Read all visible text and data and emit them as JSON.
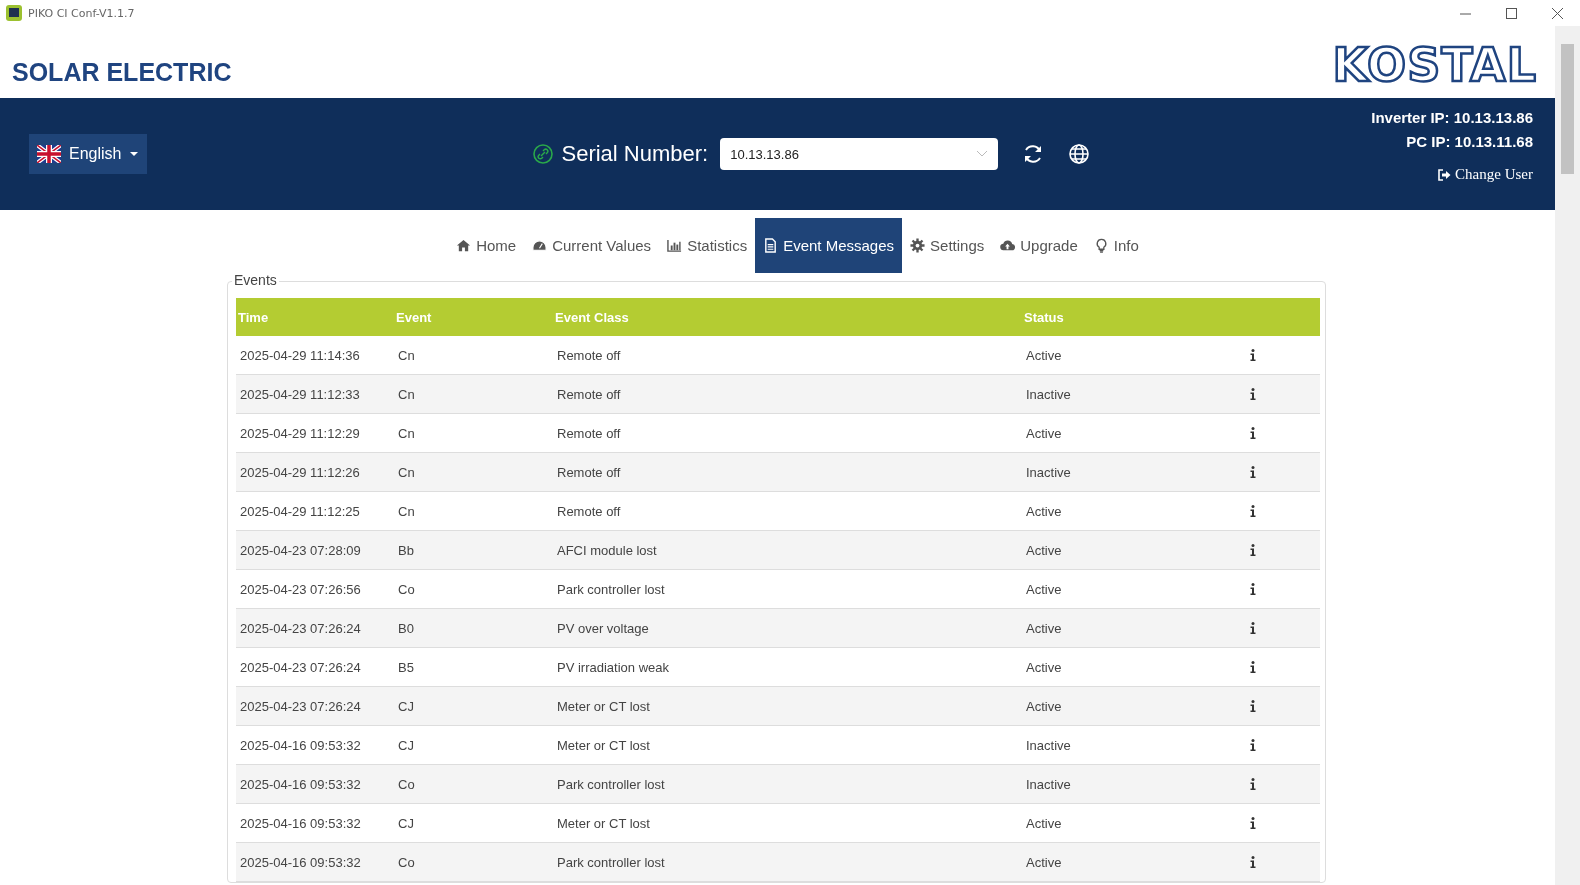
{
  "window": {
    "title": "PIKO CI Conf-V1.1.7"
  },
  "header": {
    "brand": "SOLAR ELECTRIC",
    "logo": "KOSTAL"
  },
  "toolbar": {
    "language": "English",
    "serial_label": "Serial Number:",
    "serial_value": "10.13.13.86",
    "inverter_ip": "Inverter IP: 10.13.13.86",
    "pc_ip": "PC IP: 10.13.11.68",
    "change_user": "Change User"
  },
  "tabs": [
    {
      "label": "Home",
      "selected": false
    },
    {
      "label": "Current Values",
      "selected": false
    },
    {
      "label": "Statistics",
      "selected": false
    },
    {
      "label": "Event Messages",
      "selected": true
    },
    {
      "label": "Settings",
      "selected": false
    },
    {
      "label": "Upgrade",
      "selected": false
    },
    {
      "label": "Info",
      "selected": false
    }
  ],
  "events": {
    "legend": "Events",
    "columns": [
      "Time",
      "Event",
      "Event Class",
      "Status"
    ],
    "rows": [
      {
        "time": "2025-04-29 11:14:36",
        "event": "Cn",
        "event_class": "Remote off",
        "status": "Active"
      },
      {
        "time": "2025-04-29 11:12:33",
        "event": "Cn",
        "event_class": "Remote off",
        "status": "Inactive"
      },
      {
        "time": "2025-04-29 11:12:29",
        "event": "Cn",
        "event_class": "Remote off",
        "status": "Active"
      },
      {
        "time": "2025-04-29 11:12:26",
        "event": "Cn",
        "event_class": "Remote off",
        "status": "Inactive"
      },
      {
        "time": "2025-04-29 11:12:25",
        "event": "Cn",
        "event_class": "Remote off",
        "status": "Active"
      },
      {
        "time": "2025-04-23 07:28:09",
        "event": "Bb",
        "event_class": "AFCI module lost",
        "status": "Active"
      },
      {
        "time": "2025-04-23 07:26:56",
        "event": "Co",
        "event_class": "Park controller lost",
        "status": "Active"
      },
      {
        "time": "2025-04-23 07:26:24",
        "event": "B0",
        "event_class": "PV over voltage",
        "status": "Active"
      },
      {
        "time": "2025-04-23 07:26:24",
        "event": "B5",
        "event_class": "PV irradiation weak",
        "status": "Active"
      },
      {
        "time": "2025-04-23 07:26:24",
        "event": "CJ",
        "event_class": "Meter or CT lost",
        "status": "Active"
      },
      {
        "time": "2025-04-16 09:53:32",
        "event": "CJ",
        "event_class": "Meter or CT lost",
        "status": "Inactive"
      },
      {
        "time": "2025-04-16 09:53:32",
        "event": "Co",
        "event_class": "Park controller lost",
        "status": "Inactive"
      },
      {
        "time": "2025-04-16 09:53:32",
        "event": "CJ",
        "event_class": "Meter or CT lost",
        "status": "Active"
      },
      {
        "time": "2025-04-16 09:53:32",
        "event": "Co",
        "event_class": "Park controller lost",
        "status": "Active"
      }
    ]
  }
}
